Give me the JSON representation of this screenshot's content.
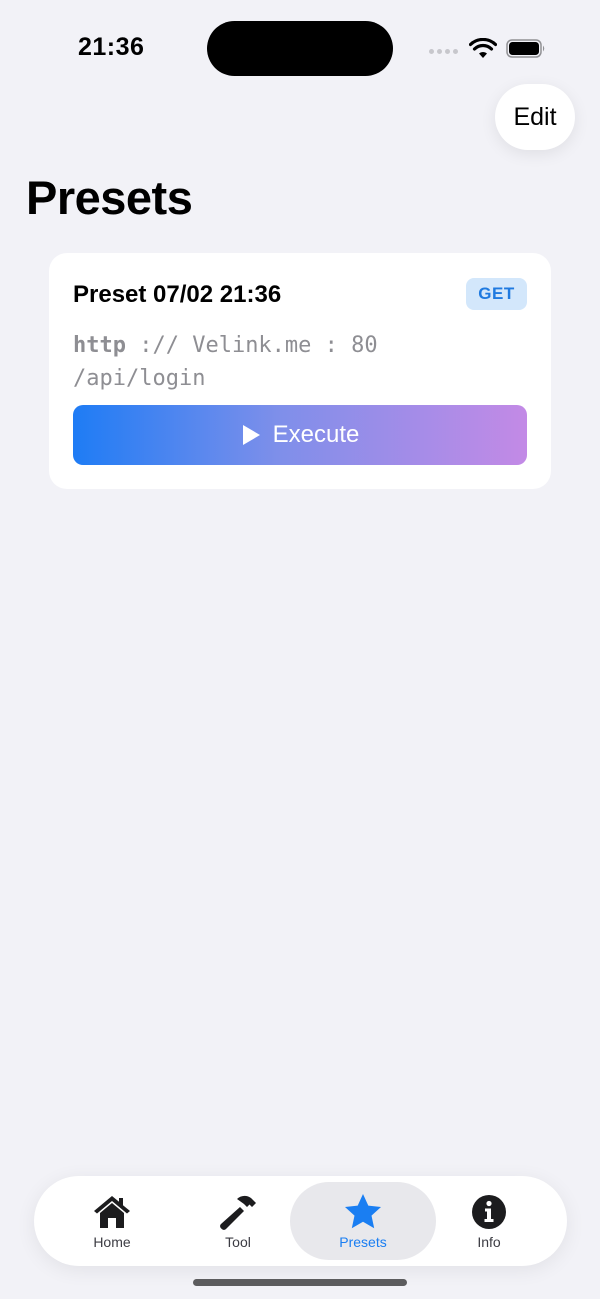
{
  "status_bar": {
    "time": "21:36"
  },
  "header": {
    "edit_label": "Edit",
    "title": "Presets"
  },
  "preset": {
    "name": "Preset 07/02 21:36",
    "method": "GET",
    "scheme": "http",
    "url_rest": " :// Velink.me : 80",
    "path": "/api/login",
    "execute_label": "Execute"
  },
  "tabs": [
    {
      "label": "Home",
      "icon": "house-icon"
    },
    {
      "label": "Tool",
      "icon": "hammer-icon"
    },
    {
      "label": "Presets",
      "icon": "star-icon",
      "active": true
    },
    {
      "label": "Info",
      "icon": "info-icon"
    }
  ],
  "colors": {
    "accent": "#1a7ef2",
    "badge_bg": "#d3e7fb",
    "background": "#f2f2f7"
  }
}
